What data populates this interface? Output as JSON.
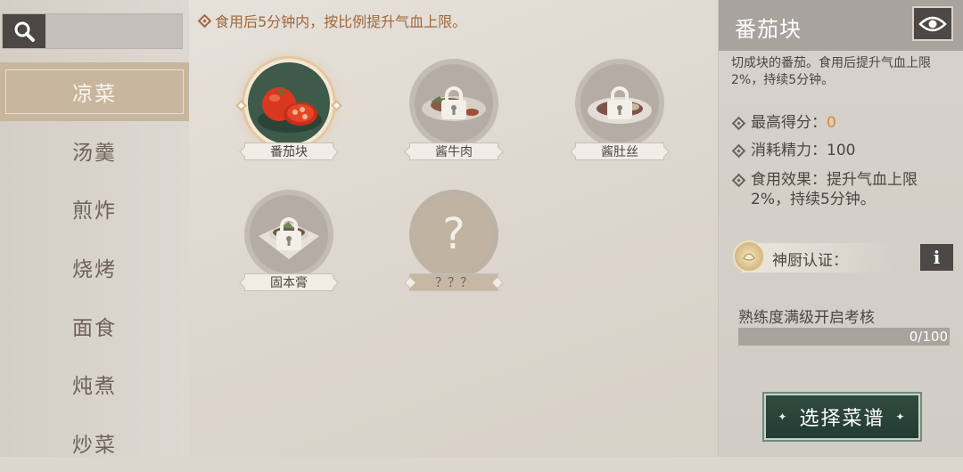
{
  "hint": "食用后5分钟内，按比例提升气血上限。",
  "search": {
    "placeholder": ""
  },
  "categories": [
    {
      "label": "凉菜",
      "active": true
    },
    {
      "label": "汤羹",
      "active": false
    },
    {
      "label": "煎炸",
      "active": false
    },
    {
      "label": "烧烤",
      "active": false
    },
    {
      "label": "面食",
      "active": false
    },
    {
      "label": "炖煮",
      "active": false
    },
    {
      "label": "炒菜",
      "active": false
    }
  ],
  "dishes": [
    {
      "name": "番茄块",
      "state": "selected",
      "icon": "tomato-icon"
    },
    {
      "name": "酱牛肉",
      "state": "locked",
      "icon": "lock-icon"
    },
    {
      "name": "酱肚丝",
      "state": "locked",
      "icon": "lock-icon"
    },
    {
      "name": "固本膏",
      "state": "locked",
      "icon": "lock-icon"
    },
    {
      "name": "？？？",
      "state": "unknown",
      "icon": "question-icon"
    }
  ],
  "panel": {
    "title": "番茄块",
    "description": "切成块的番茄。食用后提升气血上限2%，持续5分钟。",
    "best_score_label": "最高得分：",
    "best_score": "0",
    "energy": "消耗精力：100",
    "effect": "食用效果：提升气血上限2%，持续5分钟。",
    "chef_label": "神厨认证：",
    "info_label": "i",
    "proficiency_label": "熟练度满级开启考核",
    "proficiency_text": "0/100",
    "proficiency_value": 0,
    "proficiency_max": 100,
    "select_button": "选择菜谱"
  },
  "colors": {
    "accent": "#a0673a",
    "score": "#e0892f",
    "active_tab": "#c9b69e",
    "button": "#2f4b40"
  }
}
